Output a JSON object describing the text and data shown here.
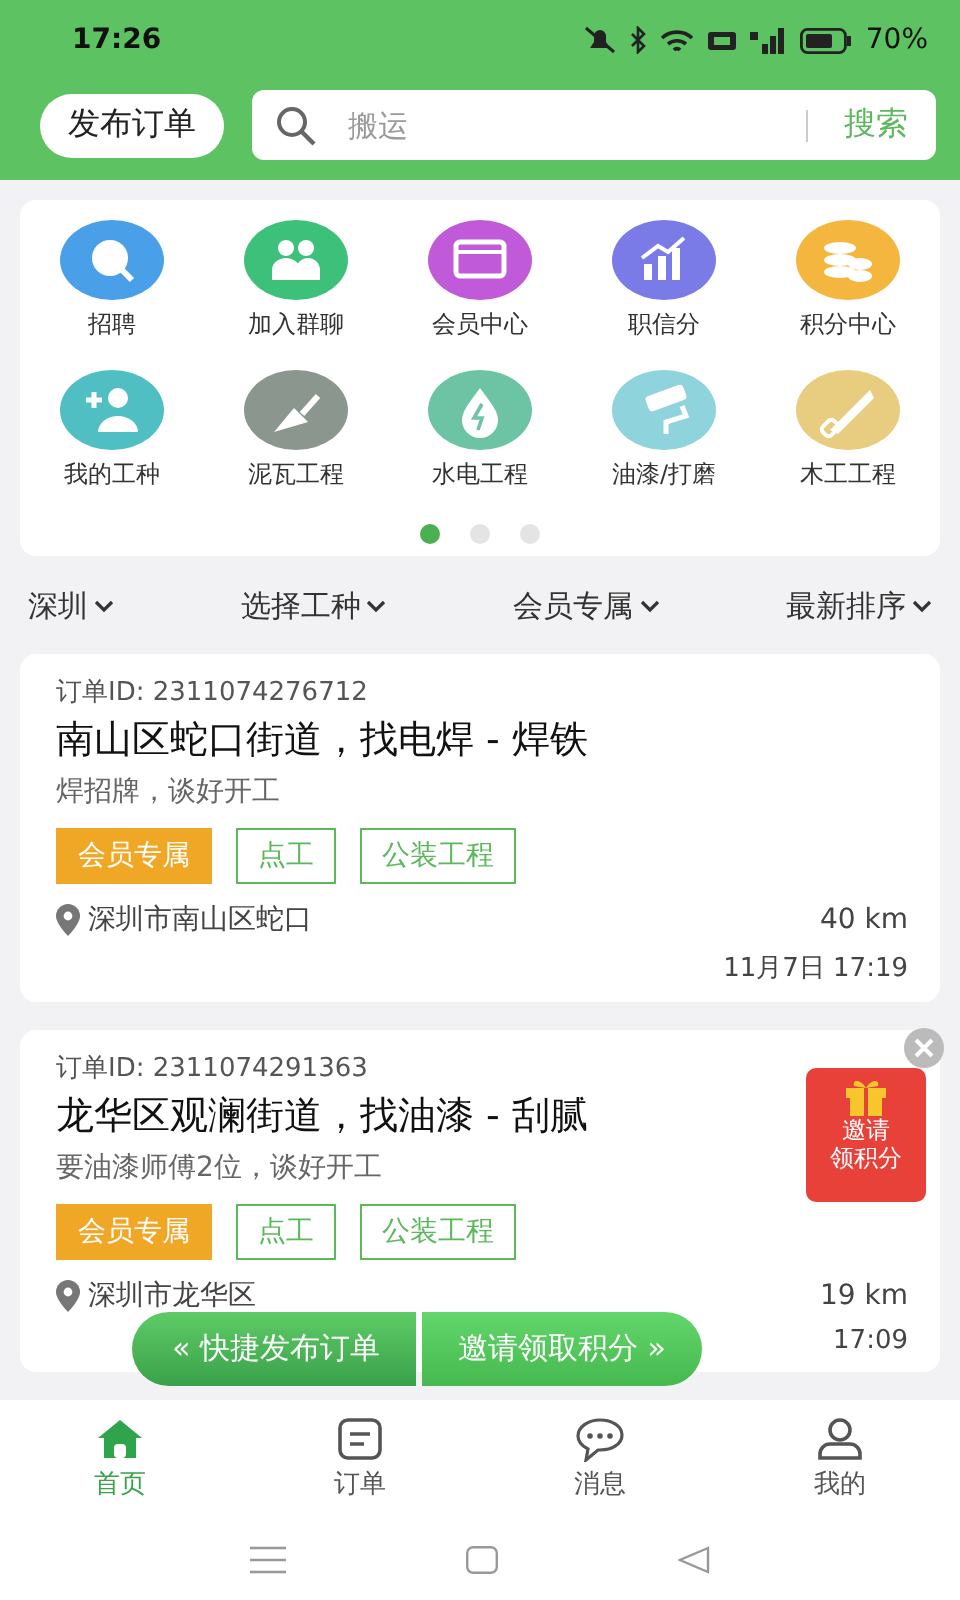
{
  "status_bar": {
    "time": "17:26",
    "battery": "70%"
  },
  "header": {
    "post_button": "发布订单",
    "search": {
      "placeholder": "搬运"
    },
    "search_button": "搜索"
  },
  "shortcuts": [
    {
      "label": "招聘",
      "kind": "search",
      "color": "#4aa0e8"
    },
    {
      "label": "加入群聊",
      "kind": "group",
      "color": "#3cc07a"
    },
    {
      "label": "会员中心",
      "kind": "vip",
      "color": "#c05ad8"
    },
    {
      "label": "职信分",
      "kind": "chart",
      "color": "#7b7be8"
    },
    {
      "label": "积分中心",
      "kind": "coins",
      "color": "#f4b63e"
    },
    {
      "label": "我的工种",
      "kind": "adduser",
      "color": "#4fbfc4"
    },
    {
      "label": "泥瓦工程",
      "kind": "trowel",
      "color": "#8a968e"
    },
    {
      "label": "水电工程",
      "kind": "bolt",
      "color": "#6cc4a4"
    },
    {
      "label": "油漆/打磨",
      "kind": "roller",
      "color": "#8fd4dc"
    },
    {
      "label": "木工工程",
      "kind": "saw",
      "color": "#e8cc80"
    }
  ],
  "pager": [
    {
      "selected": true
    },
    {
      "selected": false
    },
    {
      "selected": false
    }
  ],
  "filters": [
    "深圳",
    "选择工种",
    "会员专属",
    "最新排序"
  ],
  "orders": [
    {
      "id": "订单ID: 2311074276712",
      "title": "南山区蛇口街道，找电焊 - 焊铁",
      "desc": "焊招牌，谈好开工",
      "tags": [
        {
          "label": "会员专属",
          "kind": "member"
        },
        {
          "label": "点工",
          "kind": "outline"
        },
        {
          "label": "公装工程",
          "kind": "outline"
        }
      ],
      "location": "深圳市南山区蛇口",
      "distance": "40 km",
      "time": "11月7日 17:19"
    },
    {
      "id": "订单ID: 2311074291363",
      "title": "龙华区观澜街道，找油漆 - 刮腻",
      "desc": "要油漆师傅2位，谈好开工",
      "tags": [
        {
          "label": "会员专属",
          "kind": "member"
        },
        {
          "label": "点工",
          "kind": "outline"
        },
        {
          "label": "公装工程",
          "kind": "outline"
        }
      ],
      "location": "深圳市龙华区",
      "distance": "19 km",
      "time": "17:09"
    }
  ],
  "invite_badge": {
    "label_lines": [
      "邀请",
      "领积分"
    ]
  },
  "floating_actions": [
    "« 快捷发布订单",
    "邀请领取积分 »"
  ],
  "tab_bar": [
    {
      "label": "首页",
      "kind": "home",
      "selected": true
    },
    {
      "label": "订单",
      "kind": "list",
      "selected": false
    },
    {
      "label": "消息",
      "kind": "chat",
      "selected": false
    },
    {
      "label": "我的",
      "kind": "user",
      "selected": false
    }
  ]
}
